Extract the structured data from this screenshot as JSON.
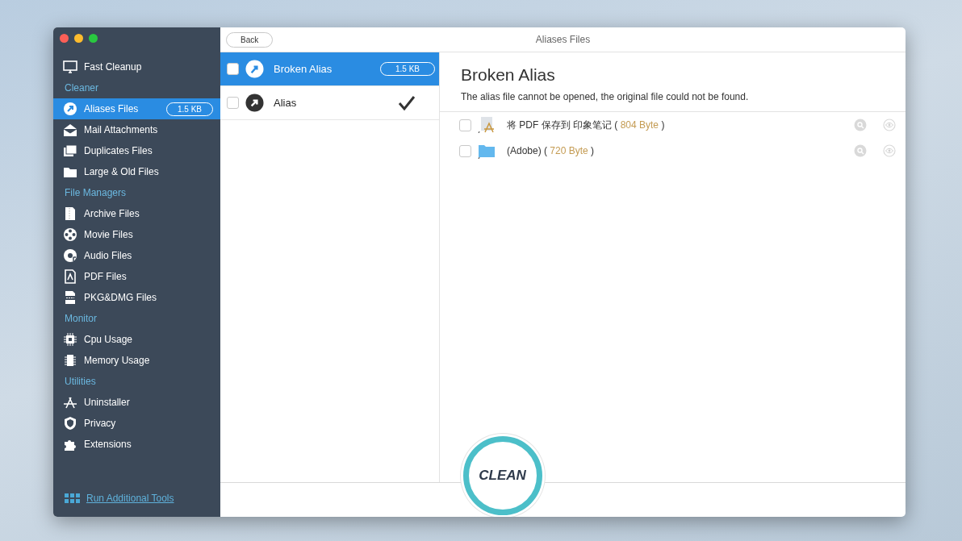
{
  "window": {
    "title": "Aliases Files",
    "back_button": "Back"
  },
  "sidebar": {
    "items": [
      {
        "kind": "item",
        "label": "Fast Cleanup",
        "selected": false
      },
      {
        "kind": "header",
        "label": "Cleaner"
      },
      {
        "kind": "item",
        "label": "Aliases Files",
        "selected": true,
        "badge": "1.5 KB"
      },
      {
        "kind": "item",
        "label": "Mail Attachments",
        "selected": false
      },
      {
        "kind": "item",
        "label": "Duplicates Files",
        "selected": false
      },
      {
        "kind": "item",
        "label": "Large & Old Files",
        "selected": false
      },
      {
        "kind": "header",
        "label": "File Managers"
      },
      {
        "kind": "item",
        "label": "Archive Files",
        "selected": false
      },
      {
        "kind": "item",
        "label": "Movie Files",
        "selected": false
      },
      {
        "kind": "item",
        "label": "Audio Files",
        "selected": false
      },
      {
        "kind": "item",
        "label": "PDF Files",
        "selected": false
      },
      {
        "kind": "item",
        "label": "PKG&DMG Files",
        "selected": false
      },
      {
        "kind": "header",
        "label": "Monitor"
      },
      {
        "kind": "item",
        "label": "Cpu Usage",
        "selected": false
      },
      {
        "kind": "item",
        "label": "Memory Usage",
        "selected": false
      },
      {
        "kind": "header",
        "label": "Utilities"
      },
      {
        "kind": "item",
        "label": "Uninstaller",
        "selected": false
      },
      {
        "kind": "item",
        "label": "Privacy",
        "selected": false
      },
      {
        "kind": "item",
        "label": "Extensions",
        "selected": false
      }
    ],
    "footer_link": "Run Additional Tools"
  },
  "groups": [
    {
      "label": "Broken Alias",
      "selected": true,
      "checked": false,
      "badge": "1.5 KB",
      "done": false
    },
    {
      "label": "Alias",
      "selected": false,
      "checked": false,
      "done": true
    }
  ],
  "detail": {
    "title": "Broken Alias",
    "description": "The alias file cannot be opened, the original file could not be found.",
    "files": [
      {
        "kind": "app",
        "name": "将 PDF 保存到 印象笔记 (",
        "size": "804 Byte",
        "close": ")",
        "checked": false
      },
      {
        "kind": "folder",
        "name": "(Adobe) (",
        "size": "720 Byte",
        "close": ")",
        "checked": false
      }
    ]
  },
  "clean_button": "CLEAN"
}
